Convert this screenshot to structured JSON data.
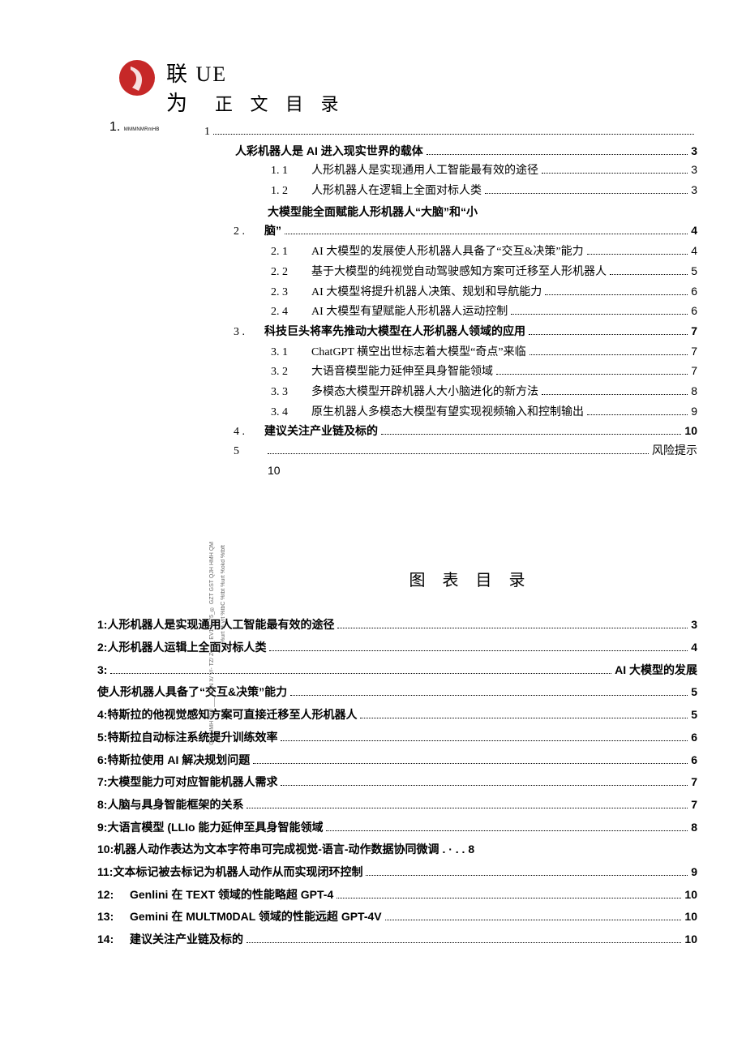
{
  "brand": {
    "line1": "联 UE",
    "line2": "为"
  },
  "titles": {
    "main": "正 文 目 录",
    "figs": "图 表 目 录"
  },
  "one": {
    "num": "1.",
    "tiny": "MMMNMRmHB",
    "page_intro": "1"
  },
  "s1": {
    "h": "人彩机器人是 AI 进入现实世界的载体",
    "hp": "3",
    "i1n": "1. 1",
    "i1t": "人形机器人是实现通用人工智能最有效的途径",
    "i1p": "3",
    "i2n": "1. 2",
    "i2t": "人形机器人在逻辑上全面对标人类",
    "i2p": "3"
  },
  "s2": {
    "num": "2",
    "h_pre": "大模型能全面赋能人形机器人“大脑”和“小",
    "h_suf": "脑”",
    "hp": "4",
    "i1n": "2. 1",
    "i1t": "AI 大模型的发展使人形机器人具备了“交互&决策”能力",
    "i1p": "4",
    "i2n": "2. 2",
    "i2t": "基于大模型的纯视觉自动驾驶感知方案可迁移至人形机器人",
    "i2p": "5",
    "i3n": "2. 3",
    "i3t": "AI 大模型将提升机器人决策、规划和导航能力",
    "i3p": "6",
    "i4n": "2. 4",
    "i4t": "AI 大模型有望赋能人形机器人运动控制",
    "i4p": "6"
  },
  "s3": {
    "num": "3",
    "h": "科技巨头将率先推动大模型在人形机器人领域的应用",
    "hp": "7",
    "i1n": "3. 1",
    "i1t": "ChatGPT 横空出世标志着大模型“奇点”来临",
    "i1p": "7",
    "i2n": "3. 2",
    "i2t": "大语音模型能力延伸至具身智能领域",
    "i2p": "7",
    "i3n": "3. 3",
    "i3t": "多模态大模型开辟机器人大小脑进化的新方法",
    "i3p": "8",
    "i4n": "3. 4",
    "i4t": "原生机器人多模态大模型有望实现视频输入和控制输出",
    "i4p": "9"
  },
  "s4": {
    "num": "4",
    "h": "建议关注产业链及标的",
    "hp": "10"
  },
  "s5": {
    "num": "5",
    "tail": "风险提示",
    "sub": "10"
  },
  "figs": {
    "f1n": "1:",
    "f1t": "人形机器人是实现通用人工智能最有效的途径",
    "f1p": "3",
    "f2n": "2:",
    "f2t": "人形机器人运辑上全面对标人类",
    "f2p": "4",
    "f3n": "3:",
    "f3tail": "AI 大模型的发展",
    "f3line2": "使人形机器人具备了“交互&决策”能力",
    "f3p": "5",
    "f4n": "4:",
    "f4t": "特斯拉的他视觉感知方案可直接迁移至人形机器人",
    "f4p": "5",
    "f5n": "5:",
    "f5t": "特斯拉自动标注系统提升训练效率",
    "f5p": "6",
    "f6n": "6:",
    "f6t": "特斯拉使用 AI 解决规划问题",
    "f6p": "6",
    "f7n": "7:",
    "f7t": "大模型能力可对应智能机器人需求",
    "f7p": "7",
    "f8n": "8:",
    "f8t": "人脑与具身智能框架的关系",
    "f8p": "7",
    "f9n": "9:",
    "f9t": "大语言模型  (LLIo 能力延伸至具身智能领域",
    "f9p": "8",
    "f10n": "10:",
    "f10t": "机器人动作表达为文本字符串可完成视觉-语言-动作数据协同微调 . · . . 8",
    "f11n": "11:",
    "f11t": "文本标记被去标记为机器人动作从而实现闭环控制",
    "f11p": "9",
    "f12n": "12:",
    "f12t": "Genlini 在 TEXT 领域的性能略超 GPT-4",
    "f12p": "10",
    "f13n": "13:",
    "f13t": "Gemini 在 MULTM0DAL 领域的性能远超 GPT-4V",
    "f13p": "10",
    "f14n": "14:",
    "f14t": "建议关注产业链及标的",
    "f14p": "10"
  },
  "watermark": {
    "a": "%urt % yrt %tbC %tbt %urt %okd %tbft",
    "b": "GX/ HMH QM/ ___ TZ N X/ V/- TZ/ Z-___ EV1 1_75_® GZT GST QJH HMH QM"
  }
}
